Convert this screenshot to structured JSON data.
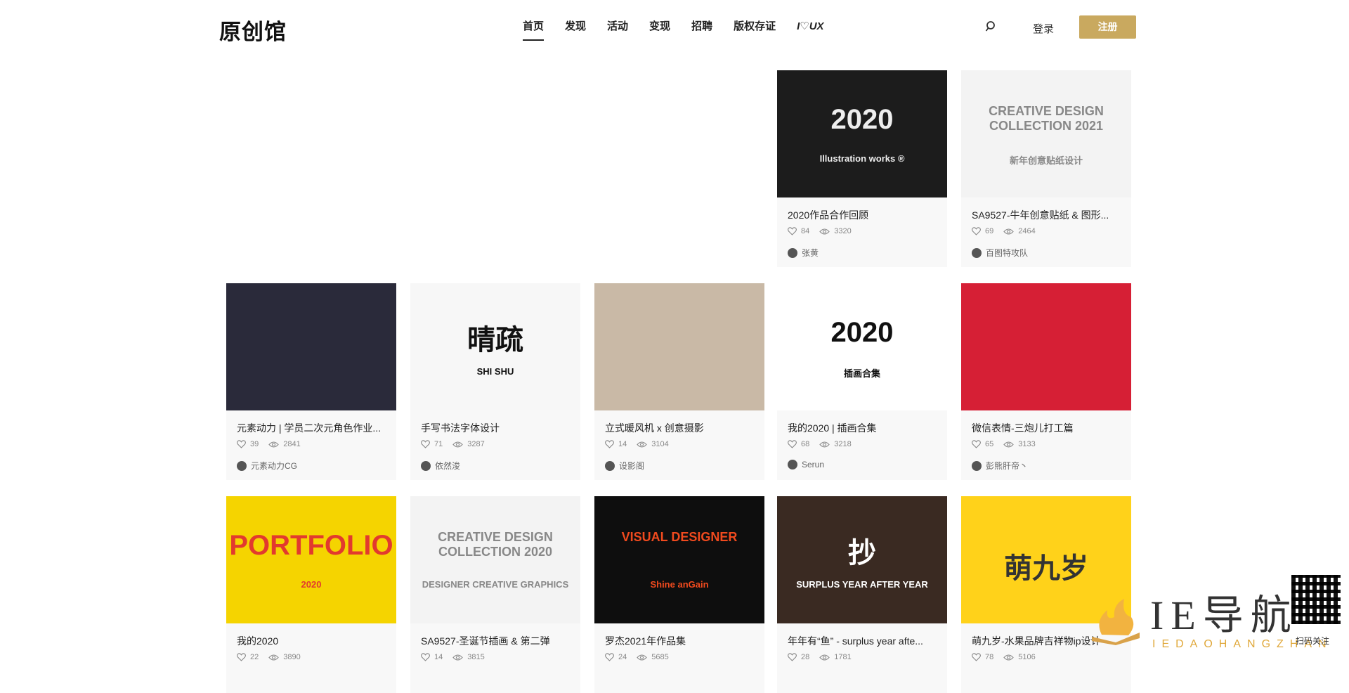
{
  "brand": {
    "logo": "原创馆"
  },
  "nav": [
    {
      "label": "首页",
      "active": true
    },
    {
      "label": "发现"
    },
    {
      "label": "活动"
    },
    {
      "label": "变现"
    },
    {
      "label": "招聘"
    },
    {
      "label": "版权存证"
    },
    {
      "label": "I♡UX"
    }
  ],
  "header": {
    "login_label": "登录",
    "register_label": "注册",
    "accent_color": "#c9a95f"
  },
  "cards": [
    {
      "title": "2020作品合作回顾",
      "likes": "84",
      "views": "3320",
      "author": "张黄",
      "thumb": {
        "bg": "#1c1c1c",
        "text": "2020",
        "subtext": "Illustration works ®",
        "fg": "#eeeeee"
      }
    },
    {
      "title": "SA9527-牛年创意贴纸 & 图形...",
      "likes": "69",
      "views": "2464",
      "author": "百图特攻队",
      "thumb": {
        "bg": "#f3f3f3",
        "text": "CREATIVE DESIGN COLLECTION 2021",
        "subtext": "新年创意贴纸设计",
        "fg": "#888888"
      }
    },
    {
      "title": "元素动力 | 学员二次元角色作业...",
      "likes": "39",
      "views": "2841",
      "author": "元素动力CG",
      "thumb": {
        "bg": "#2a2a3a",
        "text": "",
        "subtext": "",
        "fg": "#ffffff"
      }
    },
    {
      "title": "手写书法字体设计",
      "likes": "71",
      "views": "3287",
      "author": "依然浚",
      "thumb": {
        "bg": "#f7f7f7",
        "text": "晴疏",
        "subtext": "SHI SHU",
        "fg": "#111111"
      }
    },
    {
      "title": "立式暖风机 x 创意摄影",
      "likes": "14",
      "views": "3104",
      "author": "设影阁",
      "thumb": {
        "bg": "#c9b9a6",
        "text": "",
        "subtext": "",
        "fg": "#ffffff"
      }
    },
    {
      "title": "我的2020 | 插画合集",
      "likes": "68",
      "views": "3218",
      "author": "Serun",
      "thumb": {
        "bg": "#ffffff",
        "text": "2020",
        "subtext": "插画合集",
        "fg": "#111111"
      }
    },
    {
      "title": "微信表情-三炮儿打工篇",
      "likes": "65",
      "views": "3133",
      "author": "彭熊肝帝丶",
      "thumb": {
        "bg": "#d61f35",
        "text": "",
        "subtext": "",
        "fg": "#ffffff"
      }
    },
    {
      "title": "我的2020",
      "likes": "22",
      "views": "3890",
      "author": "",
      "thumb": {
        "bg": "#f5d400",
        "text": "PORTFOLIO",
        "subtext": "2020",
        "fg": "#e23a2e"
      }
    },
    {
      "title": "SA9527-圣诞节插画 & 第二弹",
      "likes": "14",
      "views": "3815",
      "author": "",
      "thumb": {
        "bg": "#f3f3f3",
        "text": "CREATIVE DESIGN COLLECTION 2020",
        "subtext": "DESIGNER CREATIVE GRAPHICS",
        "fg": "#888888"
      }
    },
    {
      "title": "罗杰2021年作品集",
      "likes": "24",
      "views": "5685",
      "author": "",
      "thumb": {
        "bg": "#0e0e0e",
        "text": "VISUAL DESIGNER",
        "subtext": "Shine anGain",
        "fg": "#f04a1e"
      }
    },
    {
      "title": "年年有“鱼” - surplus year afte...",
      "likes": "28",
      "views": "1781",
      "author": "",
      "thumb": {
        "bg": "#3a2a22",
        "text": "抄",
        "subtext": "SURPLUS YEAR AFTER YEAR",
        "fg": "#ffffff"
      }
    },
    {
      "title": "萌九岁-水果品牌吉祥物ip设计",
      "likes": "78",
      "views": "5106",
      "author": "",
      "thumb": {
        "bg": "#ffd21a",
        "text": "萌九岁",
        "subtext": "",
        "fg": "#333333"
      }
    }
  ],
  "watermark": {
    "main": "IE导航",
    "sub": "IEDAOHANGZHAN",
    "qr_label": "扫码关注"
  }
}
